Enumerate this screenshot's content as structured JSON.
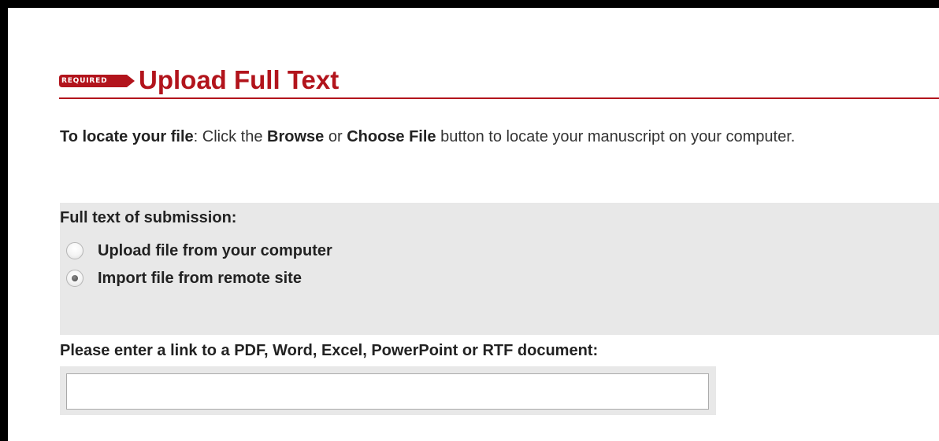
{
  "section": {
    "badge": "REQUIRED",
    "title": "Upload Full Text"
  },
  "instructions": {
    "lead_bold": "To locate your file",
    "text1": ": Click the ",
    "browse": "Browse",
    "text2": " or ",
    "choose_file": "Choose File",
    "text3": " button to locate your manuscript on your computer."
  },
  "submission": {
    "label": "Full text of submission:",
    "options": [
      {
        "label": "Upload file from your computer",
        "checked": false
      },
      {
        "label": "Import file from remote site",
        "checked": true
      }
    ]
  },
  "remote_link": {
    "label": "Please enter a link to a PDF, Word, Excel, PowerPoint or RTF document:",
    "value": "",
    "placeholder": ""
  },
  "colors": {
    "accent": "#b2141c",
    "panel": "#e8e8e8",
    "frame": "#000000"
  }
}
